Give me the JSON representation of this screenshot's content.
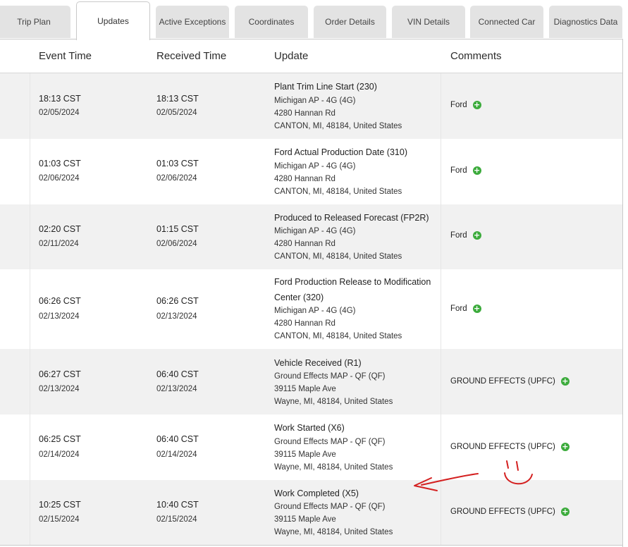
{
  "tabs": [
    {
      "label": "Trip Plan"
    },
    {
      "label": "Updates"
    },
    {
      "label": "Active Exceptions"
    },
    {
      "label": "Coordinates"
    },
    {
      "label": "Order Details"
    },
    {
      "label": "VIN Details"
    },
    {
      "label": "Connected Car"
    },
    {
      "label": "Diagnostics Data"
    }
  ],
  "active_tab": "Updates",
  "columns": {
    "event_time": "Event Time",
    "received_time": "Received Time",
    "update": "Update",
    "comments": "Comments"
  },
  "rows": [
    {
      "event_time": "18:13 CST",
      "event_date": "02/05/2024",
      "received_time": "18:13 CST",
      "received_date": "02/05/2024",
      "title": "Plant Trim Line Start (230)",
      "location": "Michigan AP - 4G (4G)",
      "street": "4280 Hannan Rd",
      "city": "CANTON, MI, 48184, United States",
      "comment": "Ford"
    },
    {
      "event_time": "01:03 CST",
      "event_date": "02/06/2024",
      "received_time": "01:03 CST",
      "received_date": "02/06/2024",
      "title": "Ford Actual Production Date (310)",
      "location": "Michigan AP - 4G (4G)",
      "street": "4280 Hannan Rd",
      "city": "CANTON, MI, 48184, United States",
      "comment": "Ford"
    },
    {
      "event_time": "02:20 CST",
      "event_date": "02/11/2024",
      "received_time": "01:15 CST",
      "received_date": "02/06/2024",
      "title": "Produced to Released Forecast (FP2R)",
      "location": "Michigan AP - 4G (4G)",
      "street": "4280 Hannan Rd",
      "city": "CANTON, MI, 48184, United States",
      "comment": "Ford"
    },
    {
      "event_time": "06:26 CST",
      "event_date": "02/13/2024",
      "received_time": "06:26 CST",
      "received_date": "02/13/2024",
      "title": "Ford Production Release to Modification Center (320)",
      "location": "Michigan AP - 4G (4G)",
      "street": "4280 Hannan Rd",
      "city": "CANTON, MI, 48184, United States",
      "comment": "Ford"
    },
    {
      "event_time": "06:27 CST",
      "event_date": "02/13/2024",
      "received_time": "06:40 CST",
      "received_date": "02/13/2024",
      "title": "Vehicle Received (R1)",
      "location": "Ground Effects MAP - QF (QF)",
      "street": "39115 Maple Ave",
      "city": "Wayne, MI, 48184, United States",
      "comment": "GROUND EFFECTS (UPFC)"
    },
    {
      "event_time": "06:25 CST",
      "event_date": "02/14/2024",
      "received_time": "06:40 CST",
      "received_date": "02/14/2024",
      "title": "Work Started (X6)",
      "location": "Ground Effects MAP - QF (QF)",
      "street": "39115 Maple Ave",
      "city": "Wayne, MI, 48184, United States",
      "comment": "GROUND EFFECTS (UPFC)"
    },
    {
      "event_time": "10:25 CST",
      "event_date": "02/15/2024",
      "received_time": "10:40 CST",
      "received_date": "02/15/2024",
      "title": "Work Completed (X5)",
      "location": "Ground Effects MAP - QF (QF)",
      "street": "39115 Maple Ave",
      "city": "Wayne, MI, 48184, United States",
      "comment": "GROUND EFFECTS (UPFC)"
    }
  ],
  "colors": {
    "row_shade": "#f1f1f1",
    "add_icon": "#3cab3c",
    "annotation": "#d42020"
  },
  "icons": {
    "add_comment": "plus-circle-icon"
  }
}
